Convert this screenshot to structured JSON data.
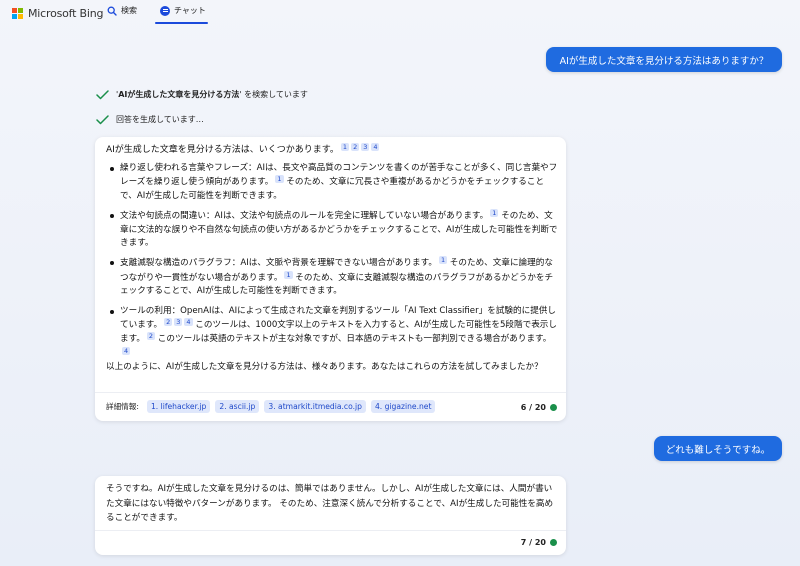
{
  "header": {
    "brand": "Microsoft Bing",
    "tabs": [
      {
        "label": "検索",
        "icon": "search-icon"
      },
      {
        "label": "チャット",
        "icon": "chat-icon",
        "active": true
      }
    ],
    "colors": {
      "accent": "#1b4adb",
      "ms_red": "#f25022",
      "ms_green": "#7fba00",
      "ms_blue": "#00a4ef",
      "ms_yellow": "#ffb900"
    }
  },
  "conversation": {
    "user_message_1": "AIが生成した文章を見分ける方法はありますか？",
    "status_1_prefix": "'",
    "status_1_query": "AIが生成した文章を見分ける方法",
    "status_1_suffix": "' を検索しています",
    "status_2": "回答を生成しています…",
    "answer_1": {
      "intro": "AIが生成した文章を見分ける方法は、いくつかあります。",
      "intro_cites": [
        "1",
        "2",
        "3",
        "4"
      ],
      "points": [
        {
          "parts": [
            {
              "text": "繰り返し使われる言葉やフレーズ：AIは、長文や高品質のコンテンツを書くのが苦手なことが多く、同じ言葉やフレーズを繰り返し使う傾向があります。"
            },
            {
              "cite": "1"
            },
            {
              "text": " そのため、文章に冗長さや重複があるかどうかをチェックすることで、AIが生成した可能性を判断できます。"
            }
          ]
        },
        {
          "parts": [
            {
              "text": "文法や句読点の間違い：AIは、文法や句読点のルールを完全に理解していない場合があります。"
            },
            {
              "cite": "1"
            },
            {
              "text": " そのため、文章に文法的な誤りや不自然な句読点の使い方があるかどうかをチェックすることで、AIが生成した可能性を判断できます。"
            }
          ]
        },
        {
          "parts": [
            {
              "text": "支離滅裂な構造のパラグラフ：AIは、文脈や背景を理解できない場合があります。"
            },
            {
              "cite": "1"
            },
            {
              "text": " そのため、文章に論理的なつながりや一貫性がない場合があります。"
            },
            {
              "cite": "1"
            },
            {
              "text": " そのため、文章に支離滅裂な構造のパラグラフがあるかどうかをチェックすることで、AIが生成した可能性を判断できます。"
            }
          ]
        },
        {
          "parts": [
            {
              "text": "ツールの利用：OpenAIは、AIによって生成された文章を判別するツール「AI Text Classifier」を試験的に提供しています。"
            },
            {
              "cite": "2"
            },
            {
              "cite": "3"
            },
            {
              "cite": "4"
            },
            {
              "text": " このツールは、1000文字以上のテキストを入力すると、AIが生成した可能性を5段階で表示します。"
            },
            {
              "cite": "2"
            },
            {
              "text": " このツールは英語のテキストが主な対象ですが、日本語のテキストも一部判別できる場合があります。"
            },
            {
              "cite": "4"
            }
          ]
        }
      ],
      "outro": "以上のように、AIが生成した文章を見分ける方法は、様々あります。あなたはこれらの方法を試してみましたか？",
      "references_label": "詳細情報:",
      "references": [
        "1. lifehacker.jp",
        "2. ascii.jp",
        "3. atmarkit.itmedia.co.jp",
        "4. gigazine.net"
      ],
      "counter": "6 / 20"
    },
    "user_message_2": "どれも難しそうですね。",
    "answer_2": {
      "text": "そうですね。AIが生成した文章を見分けるのは、簡単ではありません。しかし、AIが生成した文章には、人間が書いた文章にはない特徴やパターンがあります。 そのため、注意深く読んで分析することで、AIが生成した可能性を高めることができます。",
      "counter": "7 / 20"
    },
    "colors": {
      "user_bubble": "#1f6be0",
      "check": "#1a8f4a",
      "status_dot": "#1a8f4a",
      "cite_bg": "#d9e3fb",
      "cite_fg": "#1f49c9"
    }
  }
}
